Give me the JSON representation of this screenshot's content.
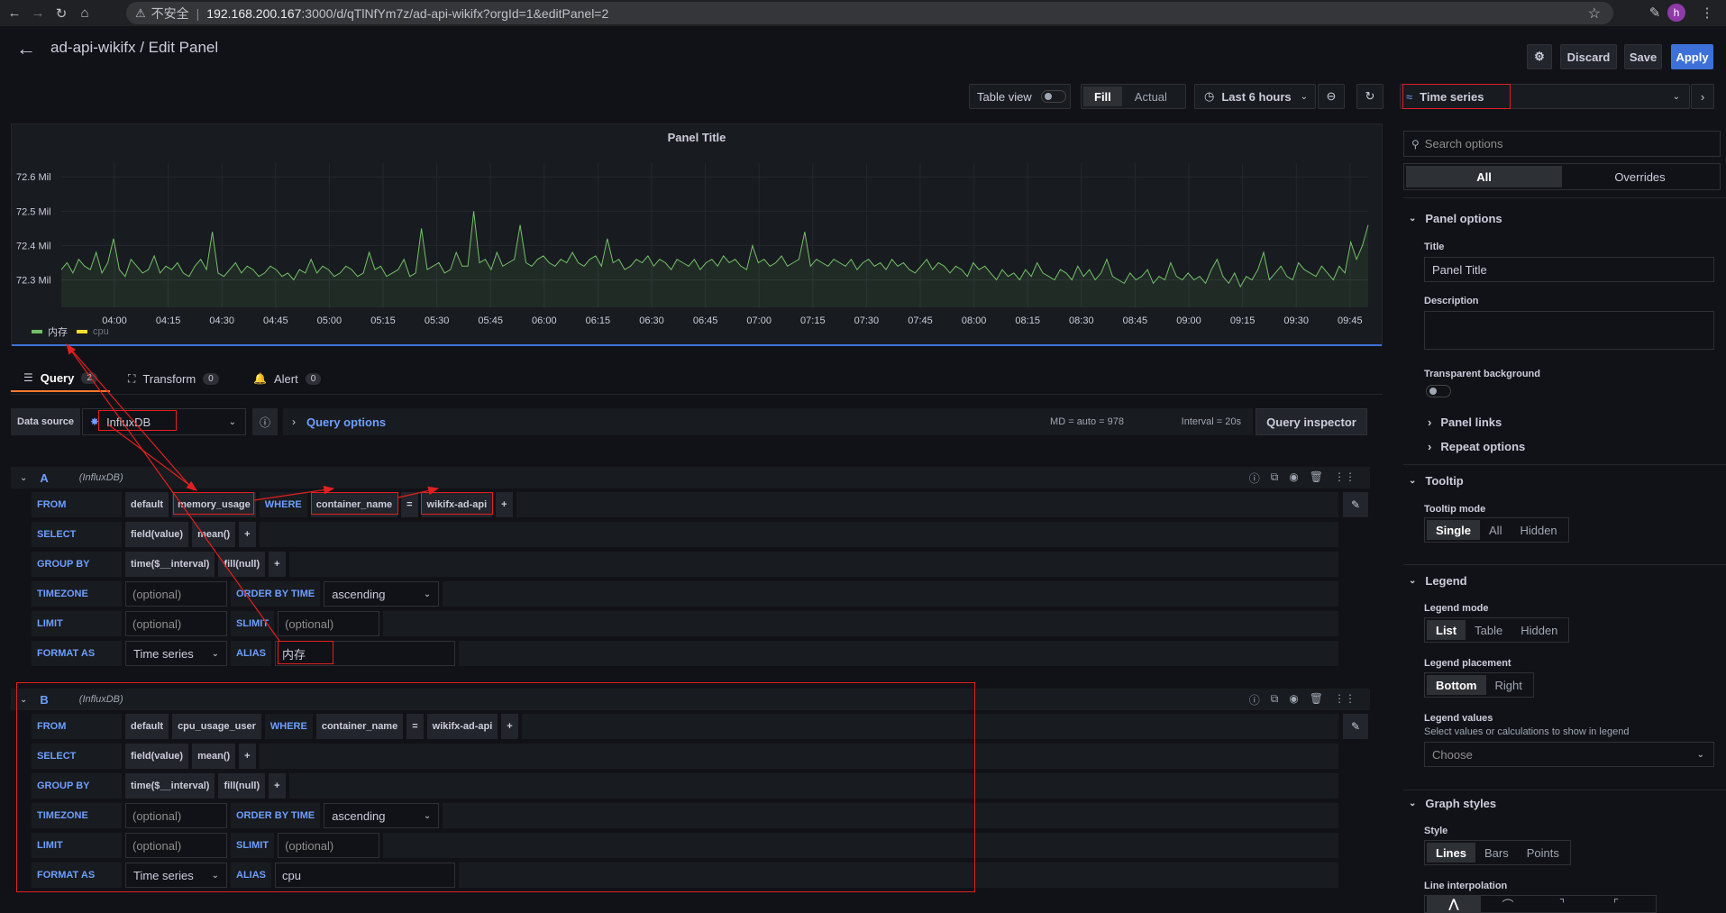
{
  "browser": {
    "insecure_label": "不安全",
    "url_host": "192.168.200.167",
    "url_rest": ":3000/d/qTlNfYm7z/ad-api-wikifx?orgId=1&editPanel=2",
    "avatar_letter": "h"
  },
  "header": {
    "title": "ad-api-wikifx / Edit Panel",
    "discard": "Discard",
    "save": "Save",
    "apply": "Apply"
  },
  "toolbar": {
    "table_view": "Table view",
    "fill": "Fill",
    "actual": "Actual",
    "time_range": "Last 6 hours",
    "viz": "Time series"
  },
  "panel": {
    "title": "Panel Title",
    "legend": [
      {
        "name": "内存",
        "color": "#73bf69"
      },
      {
        "name": "cpu",
        "color": "#fade2a"
      }
    ]
  },
  "chart_data": {
    "type": "line",
    "y_ticks": [
      "72.6 Mil",
      "72.5 Mil",
      "72.4 Mil",
      "72.3 Mil"
    ],
    "y_tick_values": [
      72.6,
      72.5,
      72.4,
      72.3
    ],
    "ylim": [
      72.22,
      72.64
    ],
    "x_ticks": [
      "04:00",
      "04:15",
      "04:30",
      "04:45",
      "05:00",
      "05:15",
      "05:30",
      "05:45",
      "06:00",
      "06:15",
      "06:30",
      "06:45",
      "07:00",
      "07:15",
      "07:30",
      "07:45",
      "08:00",
      "08:15",
      "08:30",
      "08:45",
      "09:00",
      "09:15",
      "09:30",
      "09:45"
    ],
    "series": [
      {
        "name": "内存",
        "color": "#73bf69",
        "values": [
          72.33,
          72.35,
          72.32,
          72.36,
          72.34,
          72.33,
          72.38,
          72.32,
          72.35,
          72.42,
          72.33,
          72.31,
          72.36,
          72.34,
          72.32,
          72.33,
          72.37,
          72.32,
          72.34,
          72.33,
          72.35,
          72.32,
          72.31,
          72.34,
          72.36,
          72.33,
          72.44,
          72.32,
          72.31,
          72.33,
          72.35,
          72.32,
          72.34,
          72.33,
          72.31,
          72.32,
          72.34,
          72.33,
          72.31,
          72.32,
          72.3,
          72.33,
          72.32,
          72.36,
          72.32,
          72.34,
          72.33,
          72.31,
          72.32,
          72.34,
          72.33,
          72.31,
          72.32,
          72.38,
          72.33,
          72.34,
          72.31,
          72.32,
          72.33,
          72.36,
          72.31,
          72.32,
          72.45,
          72.33,
          72.34,
          72.35,
          72.32,
          72.33,
          72.38,
          72.34,
          72.34,
          72.5,
          72.35,
          72.36,
          72.33,
          72.38,
          72.34,
          72.35,
          72.36,
          72.46,
          72.35,
          72.34,
          72.36,
          72.37,
          72.35,
          72.34,
          72.36,
          72.35,
          72.38,
          72.35,
          72.34,
          72.36,
          72.37,
          72.34,
          72.42,
          72.35,
          72.36,
          72.33,
          72.34,
          72.36,
          72.35,
          72.37,
          72.34,
          72.36,
          72.35,
          72.33,
          72.36,
          72.35,
          72.34,
          72.36,
          72.33,
          72.35,
          72.36,
          72.34,
          72.37,
          72.35,
          72.36,
          72.34,
          72.33,
          72.4,
          72.35,
          72.36,
          72.34,
          72.35,
          72.37,
          72.34,
          72.35,
          72.36,
          72.44,
          72.34,
          72.36,
          72.35,
          72.34,
          72.36,
          72.35,
          72.34,
          72.36,
          72.33,
          72.35,
          72.36,
          72.34,
          72.35,
          72.33,
          72.36,
          72.34,
          72.35,
          72.33,
          72.32,
          72.34,
          72.36,
          72.33,
          72.35,
          72.34,
          72.32,
          72.34,
          72.33,
          72.31,
          72.35,
          72.33,
          72.34,
          72.32,
          72.3,
          72.33,
          72.31,
          72.32,
          72.3,
          72.33,
          72.31,
          72.35,
          72.32,
          72.31,
          72.3,
          72.33,
          72.32,
          72.3,
          72.34,
          72.31,
          72.33,
          72.3,
          72.32,
          72.36,
          72.31,
          72.3,
          72.29,
          72.32,
          72.3,
          72.31,
          72.33,
          72.29,
          72.31,
          72.3,
          72.35,
          72.31,
          72.3,
          72.32,
          72.3,
          72.31,
          72.29,
          72.33,
          72.36,
          72.31,
          72.29,
          72.32,
          72.28,
          72.31,
          72.3,
          72.33,
          72.38,
          72.3,
          72.32,
          72.34,
          72.31,
          72.3,
          72.35,
          72.33,
          72.32,
          72.31,
          72.34,
          72.32,
          72.3,
          72.34,
          72.32,
          72.41,
          72.36,
          72.4,
          72.46
        ]
      }
    ],
    "grid": true,
    "legend_placement": "bottom-left"
  },
  "tabs": [
    {
      "label": "Query",
      "count": "2"
    },
    {
      "label": "Transform",
      "count": "0"
    },
    {
      "label": "Alert",
      "count": "0"
    }
  ],
  "datasource": {
    "label": "Data source",
    "value": "InfluxDB",
    "query_options": "Query options",
    "md": "MD = auto = 978",
    "interval": "Interval = 20s",
    "inspector": "Query inspector"
  },
  "queries": [
    {
      "ref": "A",
      "source": "(InfluxDB)",
      "from_kw": "FROM",
      "policy": "default",
      "measurement": "memory_usage",
      "where_kw": "WHERE",
      "tag": "container_name",
      "op": "=",
      "tag_value": "wikifx-ad-api",
      "select_kw": "SELECT",
      "field": "field(value)",
      "agg": "mean()",
      "group_kw": "GROUP BY",
      "time": "time($__interval)",
      "fillfn": "fill(null)",
      "tz_kw": "TIMEZONE",
      "tz_ph": "(optional)",
      "order_kw": "ORDER BY TIME",
      "order": "ascending",
      "limit_kw": "LIMIT",
      "limit_ph": "(optional)",
      "slimit_kw": "SLIMIT",
      "slimit_ph": "(optional)",
      "format_kw": "FORMAT AS",
      "format": "Time series",
      "alias_kw": "ALIAS",
      "alias": "内存",
      "plus": "+"
    },
    {
      "ref": "B",
      "source": "(InfluxDB)",
      "from_kw": "FROM",
      "policy": "default",
      "measurement": "cpu_usage_user",
      "where_kw": "WHERE",
      "tag": "container_name",
      "op": "=",
      "tag_value": "wikifx-ad-api",
      "select_kw": "SELECT",
      "field": "field(value)",
      "agg": "mean()",
      "group_kw": "GROUP BY",
      "time": "time($__interval)",
      "fillfn": "fill(null)",
      "tz_kw": "TIMEZONE",
      "tz_ph": "(optional)",
      "order_kw": "ORDER BY TIME",
      "order": "ascending",
      "limit_kw": "LIMIT",
      "limit_ph": "(optional)",
      "slimit_kw": "SLIMIT",
      "slimit_ph": "(optional)",
      "format_kw": "FORMAT AS",
      "format": "Time series",
      "alias_kw": "ALIAS",
      "alias": "cpu",
      "plus": "+"
    }
  ],
  "options": {
    "search_ph": "Search options",
    "tab_all": "All",
    "tab_overrides": "Overrides",
    "panel_options": "Panel options",
    "title_label": "Title",
    "title_value": "Panel Title",
    "description_label": "Description",
    "transparent_label": "Transparent background",
    "panel_links": "Panel links",
    "repeat_options": "Repeat options",
    "tooltip": "Tooltip",
    "tooltip_mode": "Tooltip mode",
    "tooltip_opts": [
      "Single",
      "All",
      "Hidden"
    ],
    "legend": "Legend",
    "legend_mode": "Legend mode",
    "legend_mode_opts": [
      "List",
      "Table",
      "Hidden"
    ],
    "legend_placement": "Legend placement",
    "legend_placement_opts": [
      "Bottom",
      "Right"
    ],
    "legend_values": "Legend values",
    "legend_values_desc": "Select values or calculations to show in legend",
    "legend_values_ph": "Choose",
    "graph_styles": "Graph styles",
    "style": "Style",
    "style_opts": [
      "Lines",
      "Bars",
      "Points"
    ],
    "line_interp": "Line interpolation"
  }
}
